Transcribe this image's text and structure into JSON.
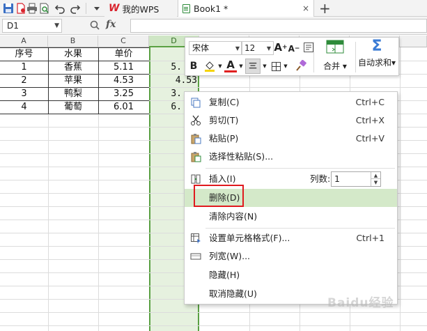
{
  "titlebar": {
    "quick_access_icons": [
      "save-icon",
      "new-file-icon",
      "print-icon",
      "print-preview-icon",
      "undo-icon",
      "redo-icon",
      "customize-dropdown-icon"
    ],
    "tabs": [
      {
        "label": "我的WPS",
        "logo": "W"
      },
      {
        "label": "Book1 *",
        "close": "×"
      }
    ],
    "add_tab": "+"
  },
  "formula_bar": {
    "name_box": "D1",
    "fx_label": "fx",
    "value": ""
  },
  "grid": {
    "columns": [
      "A",
      "B",
      "C",
      "D"
    ],
    "selected_column": "D",
    "table": {
      "headers": [
        "序号",
        "水果",
        "单价"
      ],
      "rows": [
        {
          "num": "1",
          "fruit": "香蕉",
          "price": "5.11",
          "d": "5."
        },
        {
          "num": "2",
          "fruit": "苹果",
          "price": "4.53",
          "d": "4.53"
        },
        {
          "num": "3",
          "fruit": "鸭梨",
          "price": "3.25",
          "d": "3."
        },
        {
          "num": "4",
          "fruit": "葡萄",
          "price": "6.01",
          "d": "6."
        }
      ]
    }
  },
  "mini_toolbar": {
    "font": "宋体",
    "size": "12",
    "grow_font": "A+",
    "shrink_font": "A-",
    "bold": "B",
    "font_color_glyph": "A",
    "merge_label": "合并",
    "autosum_label": "自动求和",
    "autosum_glyph": "Σ",
    "colors": {
      "fill": "#f5d300",
      "font": "#e02020"
    }
  },
  "context_menu": {
    "items": [
      {
        "label": "复制(C)",
        "shortcut": "Ctrl+C",
        "icon": "copy-icon"
      },
      {
        "label": "剪切(T)",
        "shortcut": "Ctrl+X",
        "icon": "cut-icon"
      },
      {
        "label": "粘贴(P)",
        "shortcut": "Ctrl+V",
        "icon": "paste-icon"
      },
      {
        "label": "选择性粘贴(S)...",
        "shortcut": "",
        "icon": "paste-special-icon"
      },
      {
        "label": "插入(I)",
        "shortcut": "",
        "icon": "insert-icon"
      },
      {
        "label": "删除(D)",
        "shortcut": "",
        "icon": ""
      },
      {
        "label": "清除内容(N)",
        "shortcut": "",
        "icon": ""
      },
      {
        "label": "设置单元格格式(F)...",
        "shortcut": "Ctrl+1",
        "icon": "format-cells-icon"
      },
      {
        "label": "列宽(W)...",
        "shortcut": "",
        "icon": "column-width-icon"
      },
      {
        "label": "隐藏(H)",
        "shortcut": "",
        "icon": ""
      },
      {
        "label": "取消隐藏(U)",
        "shortcut": "",
        "icon": ""
      }
    ],
    "columns_label": "列数:",
    "columns_value": "1"
  },
  "colors": {
    "accent_green": "#5aa043",
    "selection_fill": "#e6f1df",
    "highlight": "#d4e9c9",
    "callout_red": "#e0191e"
  },
  "watermark": "Baidu经验"
}
